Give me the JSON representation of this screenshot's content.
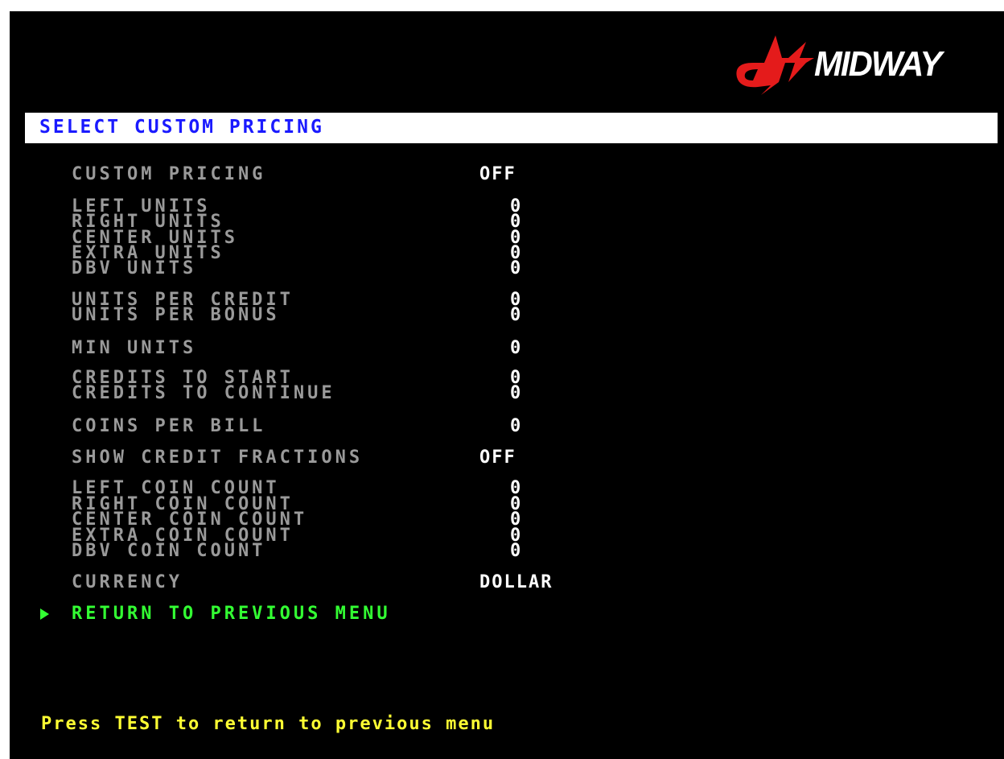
{
  "brand": {
    "name": "MIDWAY",
    "logo_colors": {
      "mark": "#e41b1b",
      "text": "#ffffff"
    }
  },
  "title": "SELECT CUSTOM PRICING",
  "menu": {
    "custom_pricing": {
      "label": "CUSTOM PRICING",
      "value": "OFF"
    },
    "left_units": {
      "label": "LEFT UNITS",
      "value": "0"
    },
    "right_units": {
      "label": "RIGHT UNITS",
      "value": "0"
    },
    "center_units": {
      "label": "CENTER UNITS",
      "value": "0"
    },
    "extra_units": {
      "label": "EXTRA UNITS",
      "value": "0"
    },
    "dbv_units": {
      "label": "DBV UNITS",
      "value": "0"
    },
    "units_per_credit": {
      "label": "UNITS PER CREDIT",
      "value": "0"
    },
    "units_per_bonus": {
      "label": "UNITS PER BONUS",
      "value": "0"
    },
    "min_units": {
      "label": "MIN UNITS",
      "value": "0"
    },
    "credits_to_start": {
      "label": "CREDITS TO START",
      "value": "0"
    },
    "credits_to_continue": {
      "label": "CREDITS TO CONTINUE",
      "value": "0"
    },
    "coins_per_bill": {
      "label": "COINS PER BILL",
      "value": "0"
    },
    "show_credit_fractions": {
      "label": "SHOW CREDIT FRACTIONS",
      "value": "OFF"
    },
    "left_coin_count": {
      "label": "LEFT COIN COUNT",
      "value": "0"
    },
    "right_coin_count": {
      "label": "RIGHT COIN COUNT",
      "value": "0"
    },
    "center_coin_count": {
      "label": "CENTER COIN COUNT",
      "value": "0"
    },
    "extra_coin_count": {
      "label": "EXTRA COIN COUNT",
      "value": "0"
    },
    "dbv_coin_count": {
      "label": "DBV COIN COUNT",
      "value": "0"
    },
    "currency": {
      "label": "CURRENCY",
      "value": "DOLLAR"
    }
  },
  "return_item": {
    "label": "RETURN TO PREVIOUS MENU",
    "selected": true
  },
  "footer": "Press TEST to return to previous menu",
  "colors": {
    "background": "#000000",
    "title_bar": "#ffffff",
    "title_text": "#1a1aff",
    "label": "#9a9a9a",
    "value": "#ffffff",
    "selected": "#33ff33",
    "footer": "#ffff33"
  }
}
